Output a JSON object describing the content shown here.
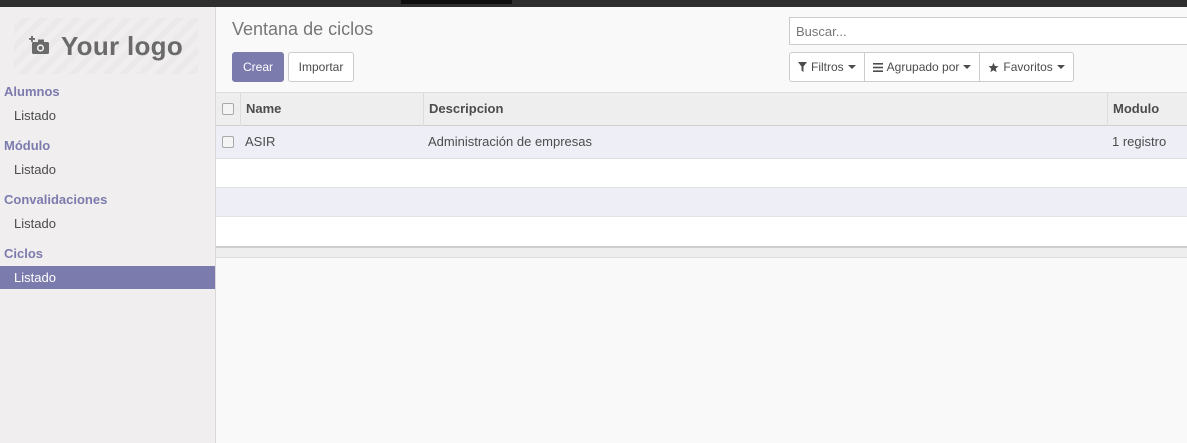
{
  "logo": {
    "text": "Your logo",
    "icon": "camera-plus-icon"
  },
  "sidebar": {
    "sections": [
      {
        "label": "Alumnos",
        "items": [
          {
            "label": "Listado"
          }
        ]
      },
      {
        "label": "Módulo",
        "items": [
          {
            "label": "Listado"
          }
        ]
      },
      {
        "label": "Convalidaciones",
        "items": [
          {
            "label": "Listado"
          }
        ]
      },
      {
        "label": "Ciclos",
        "items": [
          {
            "label": "Listado",
            "active": true
          }
        ]
      }
    ]
  },
  "control_panel": {
    "title": "Ventana de ciclos",
    "create_label": "Crear",
    "import_label": "Importar",
    "search_placeholder": "Buscar...",
    "filters_label": "Filtros",
    "group_by_label": "Agrupado por",
    "favorites_label": "Favoritos"
  },
  "table": {
    "columns": [
      "Name",
      "Descripcion",
      "Modulo"
    ],
    "rows": [
      {
        "name": "ASIR",
        "descripcion": "Administración de empresas",
        "modulo": "1 registro"
      }
    ]
  },
  "colors": {
    "accent": "#7c7bad",
    "topbar": "#2f2f2f",
    "row_alt": "#eeeef6"
  }
}
